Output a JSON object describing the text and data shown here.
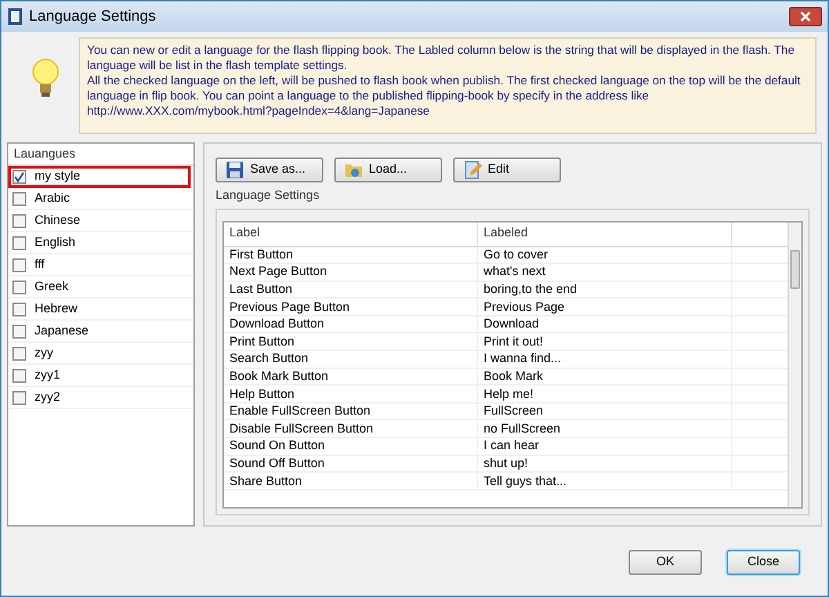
{
  "window": {
    "title": "Language Settings"
  },
  "info": {
    "paragraphs": [
      "You can new or edit a language for the flash flipping book. The Labled column below is the string that will be displayed in the flash.  The language will be list in the flash template settings.",
      "All the checked language on the left, will be pushed to flash book when publish. The first checked language on the top will be the default language in flip book. You can point a language to the published flipping-book by  specify in the address like http://www.XXX.com/mybook.html?pageIndex=4&lang=Japanese"
    ]
  },
  "languages": {
    "heading": "Lauangues",
    "items": [
      {
        "name": "my style",
        "checked": true,
        "highlighted": true
      },
      {
        "name": "Arabic",
        "checked": false,
        "highlighted": false
      },
      {
        "name": "Chinese",
        "checked": false,
        "highlighted": false
      },
      {
        "name": "English",
        "checked": false,
        "highlighted": false
      },
      {
        "name": "fff",
        "checked": false,
        "highlighted": false
      },
      {
        "name": "Greek",
        "checked": false,
        "highlighted": false
      },
      {
        "name": "Hebrew",
        "checked": false,
        "highlighted": false
      },
      {
        "name": "Japanese",
        "checked": false,
        "highlighted": false
      },
      {
        "name": "zyy",
        "checked": false,
        "highlighted": false
      },
      {
        "name": "zyy1",
        "checked": false,
        "highlighted": false
      },
      {
        "name": "zyy2",
        "checked": false,
        "highlighted": false
      }
    ]
  },
  "toolbar": [
    {
      "label": "Save as...",
      "kind": "save"
    },
    {
      "label": "Load...",
      "kind": "load"
    },
    {
      "label": "Edit",
      "kind": "edit"
    }
  ],
  "settings": {
    "title": "Language Settings",
    "columns": [
      "Label",
      "Labeled"
    ],
    "rows": [
      [
        "First Button",
        "Go to cover"
      ],
      [
        "Next Page Button",
        "what's next"
      ],
      [
        "Last Button",
        "boring,to the end"
      ],
      [
        "Previous Page Button",
        "Previous Page"
      ],
      [
        "Download Button",
        "Download"
      ],
      [
        "Print Button",
        "Print it out!"
      ],
      [
        "Search Button",
        "I wanna find..."
      ],
      [
        "Book Mark Button",
        "Book Mark"
      ],
      [
        "Help Button",
        "Help me!"
      ],
      [
        "Enable FullScreen Button",
        "FullScreen"
      ],
      [
        "Disable FullScreen Button",
        "no FullScreen"
      ],
      [
        "Sound On Button",
        "I can hear"
      ],
      [
        "Sound Off Button",
        "shut up!"
      ],
      [
        "Share Button",
        "Tell guys that..."
      ]
    ]
  },
  "buttons": [
    {
      "label": "OK",
      "focused": false
    },
    {
      "label": "Close",
      "focused": true
    }
  ]
}
